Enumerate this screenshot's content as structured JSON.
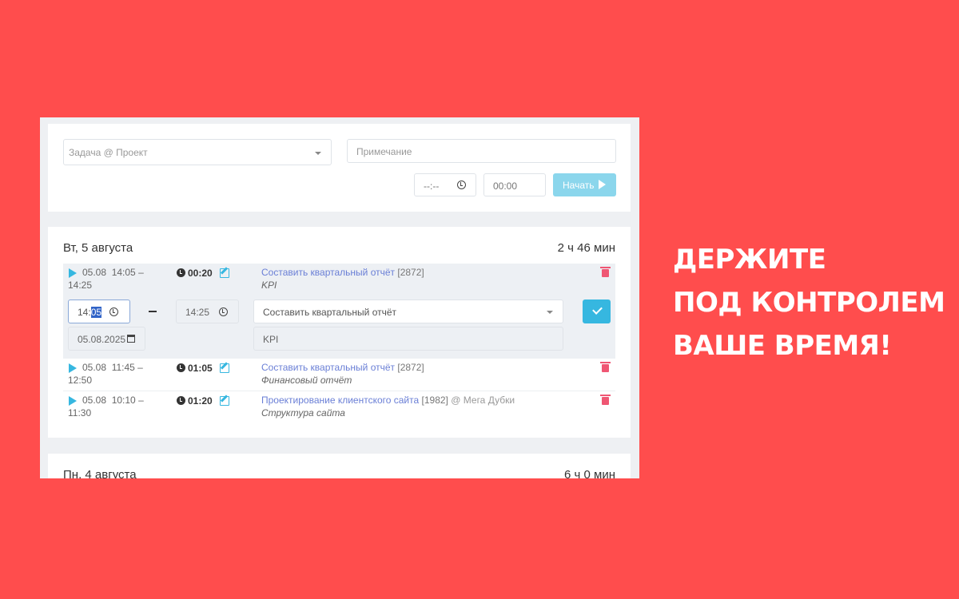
{
  "entry": {
    "task_placeholder": "Задача @ Проект",
    "note_placeholder": "Примечание",
    "time_placeholder": "--:--",
    "duration_value": "00:00",
    "start_label": "Начать"
  },
  "days": [
    {
      "title": "Вт, 5 августа",
      "total": "2 ч 46 мин",
      "rows": [
        {
          "date": "05.08",
          "range_start": "14:05 –",
          "range_end": "14:25",
          "duration": "00:20",
          "task": "Составить квартальный отчёт",
          "task_id": "[2872]",
          "project": "",
          "note": "KPI"
        },
        {
          "date": "05.08",
          "range_start": "11:45 –",
          "range_end": "12:50",
          "duration": "01:05",
          "task": "Составить квартальный отчёт",
          "task_id": "[2872]",
          "project": "",
          "note": "Финансовый отчёт"
        },
        {
          "date": "05.08",
          "range_start": "10:10 –",
          "range_end": "11:30",
          "duration": "01:20",
          "task": "Проектирование клиентского сайта",
          "task_id": "[1982]",
          "project": "@ Мега Дубки",
          "note": "Структура сайта"
        }
      ]
    },
    {
      "title": "Пн, 4 августа",
      "total": "6 ч 0 мин"
    }
  ],
  "edit_form": {
    "start_hours": "14:",
    "start_minutes": "05",
    "end_time": "14:25",
    "date": "05.08.2025",
    "task_select": "Составить квартальный отчёт",
    "note": "KPI"
  },
  "headline": [
    "ДЕРЖИТЕ",
    "ПОД КОНТРОЛЕМ",
    "ВАШЕ ВРЕМЯ!"
  ],
  "colors": {
    "background": "#ff4d4d",
    "accent": "#36b7e0",
    "link": "#6a7fd6",
    "delete": "#ef5673"
  }
}
